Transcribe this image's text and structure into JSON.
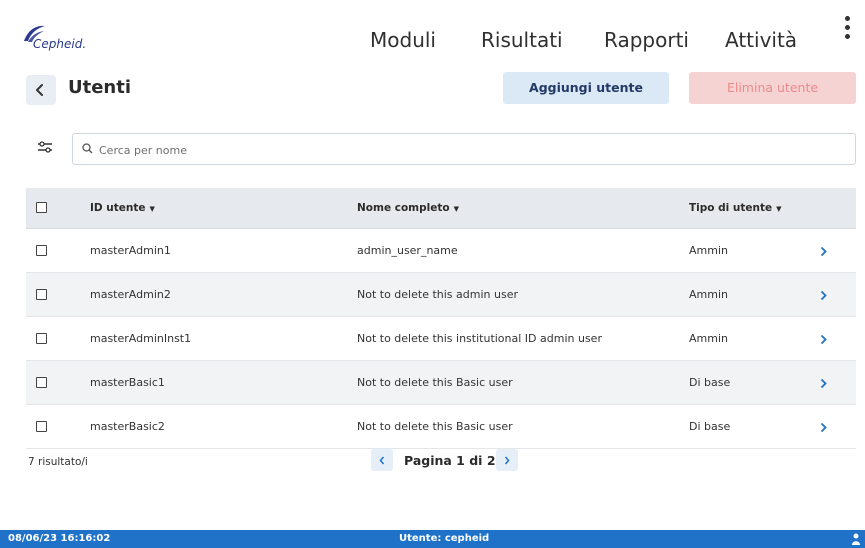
{
  "header": {
    "logo_text": "Cepheid.",
    "nav": [
      "Moduli",
      "Risultati",
      "Rapporti",
      "Attività"
    ]
  },
  "page": {
    "title": "Utenti",
    "add_button": "Aggiungi utente",
    "delete_button": "Elimina utente"
  },
  "search": {
    "placeholder": "Cerca per nome",
    "value": ""
  },
  "table": {
    "columns": [
      "ID utente",
      "Nome completo",
      "Tipo di utente"
    ],
    "rows": [
      {
        "id": "masterAdmin1",
        "name": "admin_user_name",
        "type": "Ammin"
      },
      {
        "id": "masterAdmin2",
        "name": "Not to delete this admin user",
        "type": "Ammin"
      },
      {
        "id": "masterAdminInst1",
        "name": "Not to delete this institutional ID admin user",
        "type": "Ammin"
      },
      {
        "id": "masterBasic1",
        "name": "Not to delete this Basic user",
        "type": "Di base"
      },
      {
        "id": "masterBasic2",
        "name": "Not to delete this Basic user",
        "type": "Di base"
      }
    ]
  },
  "footer": {
    "result_count": "7 risultato/i",
    "pagination": "Pagina 1 di 2"
  },
  "status": {
    "datetime": "08/06/23 16:16:02",
    "user": "Utente: cepheid"
  },
  "colors": {
    "status_bar": "#1f72c7",
    "accent_link": "#1f72c7",
    "brand": "#2a3a8f",
    "delete_disabled_bg": "#f6d3d3"
  },
  "icons": [
    "cepheid-logo-icon",
    "kebab-menu-icon",
    "back-arrow-icon",
    "filter-sliders-icon",
    "search-icon",
    "sort-caret-icon",
    "chevron-right-icon",
    "prev-page-icon",
    "next-page-icon",
    "status-indicator-icon"
  ]
}
